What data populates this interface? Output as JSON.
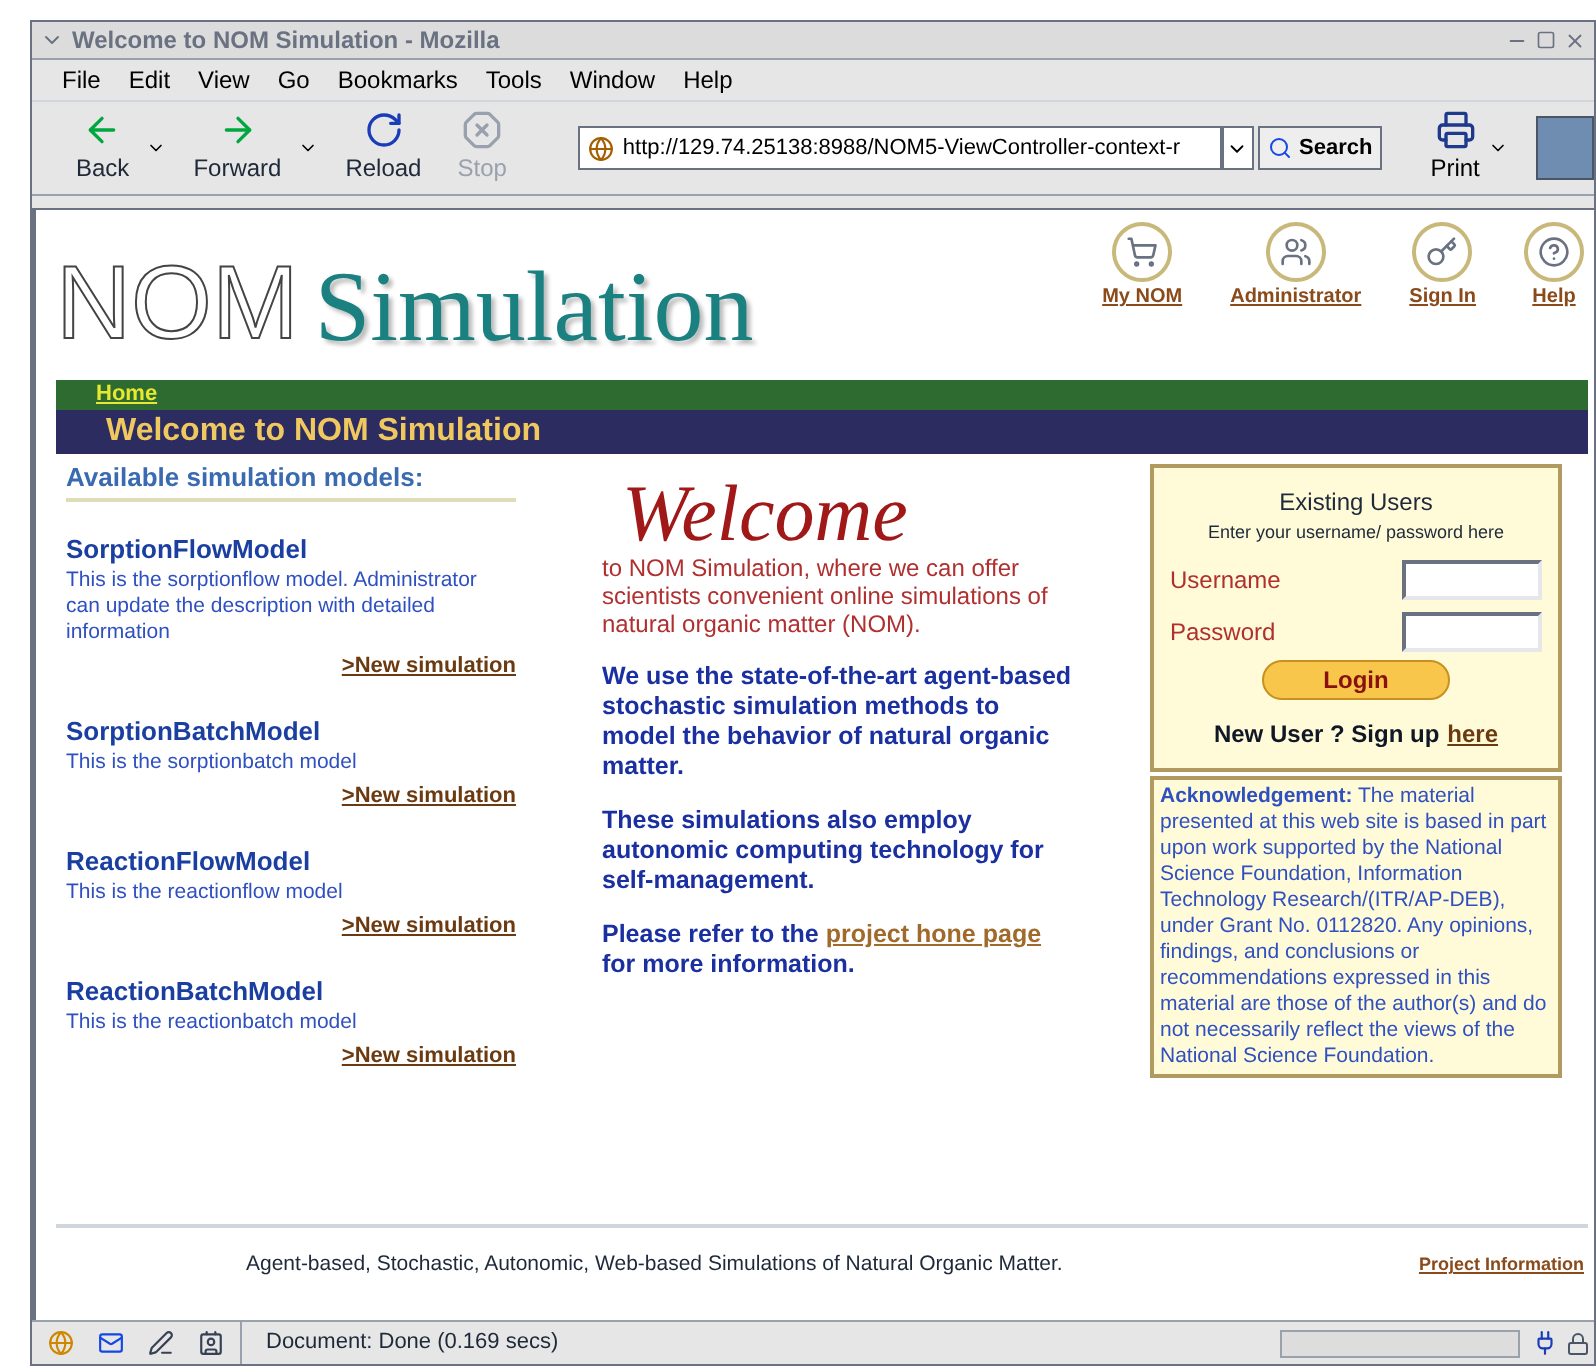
{
  "window": {
    "title": "Welcome to NOM Simulation - Mozilla"
  },
  "menu": [
    "File",
    "Edit",
    "View",
    "Go",
    "Bookmarks",
    "Tools",
    "Window",
    "Help"
  ],
  "toolbar": [
    {
      "kind": "back",
      "label": "Back",
      "disabled": false
    },
    {
      "kind": "forward",
      "label": "Forward",
      "disabled": false
    },
    {
      "kind": "reload",
      "label": "Reload",
      "disabled": false
    },
    {
      "kind": "stop",
      "label": "Stop",
      "disabled": true
    }
  ],
  "address": {
    "url": "http://129.74.25138:8988/NOM5-ViewController-context-r"
  },
  "search_button": "Search",
  "print_button": "Print",
  "page": {
    "logo": {
      "outline": "NOM",
      "title": "Simulation"
    },
    "nav_links": [
      {
        "kind": "cart",
        "label": "My NOM"
      },
      {
        "kind": "admin",
        "label": "Administrator"
      },
      {
        "kind": "key",
        "label": "Sign In"
      },
      {
        "kind": "help",
        "label": "Help"
      }
    ],
    "breadcrumb": "Home",
    "banner": "Welcome to NOM Simulation",
    "models_heading": "Available simulation models:",
    "models": [
      {
        "name": "SorptionFlowModel",
        "description": "This is the sorptionflow model. Administrator can update the description with detailed information",
        "link": ">New simulation"
      },
      {
        "name": "SorptionBatchModel",
        "description": "This is the sorptionbatch model",
        "link": ">New simulation"
      },
      {
        "name": "ReactionFlowModel",
        "description": "This is the reactionflow model",
        "link": ">New simulation"
      },
      {
        "name": "ReactionBatchModel",
        "description": "This is the reactionbatch model",
        "link": ">New simulation"
      }
    ],
    "welcome_heading": "Welcome",
    "intro": "to NOM Simulation, where we can offer scientists convenient online simulations of natural organic matter (NOM).",
    "paragraphs": [
      "We use the state-of-the-art agent-based stochastic simulation methods to model the behavior of natural organic matter.",
      "These simulations also employ autonomic computing technology for self-management."
    ],
    "refer": {
      "text": "Please refer to the",
      "link": "project hone page",
      "after": "for more information."
    },
    "login": {
      "title": "Existing Users",
      "subtitle": "Enter your username/ password here",
      "fields": [
        {
          "label": "Username"
        },
        {
          "label": "Password"
        }
      ],
      "button": "Login",
      "signup_text": "New User ? Sign up",
      "signup_link": "here"
    },
    "acknowledgement": {
      "text": "**Acknowledgement:** The material presented at this web site is based in part upon work supported by the National Science Foundation, Information Technology Research/(ITR/AP-DEB), under Grant No. 0112820. Any opinions, findings, and conclusions or recommendations expressed in this material are those of the author(s) and do not necessarily reflect the views of the National Science Foundation."
    },
    "footer": {
      "tagline": "Agent-based, Stochastic, Autonomic, Web-based Simulations of Natural Organic Matter.",
      "link": "Project Information"
    }
  },
  "status_bar": {
    "text": "Document: Done (0.169 secs)"
  }
}
